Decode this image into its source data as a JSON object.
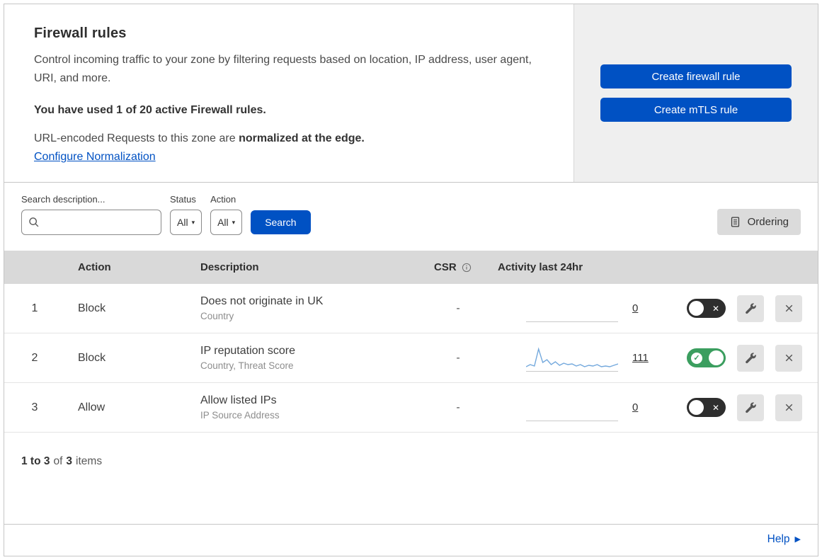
{
  "header": {
    "title": "Firewall rules",
    "description": "Control incoming traffic to your zone by filtering requests based on location, IP address, user agent, URI, and more.",
    "usage": "You have used 1 of 20 active Firewall rules.",
    "normalization_prefix": "URL-encoded Requests to this zone are ",
    "normalization_bold": "normalized at the edge.",
    "normalization_link": "Configure Normalization",
    "create_firewall_label": "Create firewall rule",
    "create_mtls_label": "Create mTLS rule"
  },
  "filters": {
    "search_label": "Search description...",
    "status_label": "Status",
    "status_value": "All",
    "action_label": "Action",
    "action_value": "All",
    "search_button": "Search",
    "ordering_button": "Ordering"
  },
  "table": {
    "headers": {
      "action": "Action",
      "description": "Description",
      "csr": "CSR",
      "activity": "Activity last 24hr"
    },
    "rows": [
      {
        "priority": "1",
        "action": "Block",
        "description": "Does not originate in UK",
        "criteria": "Country",
        "csr": "-",
        "activity_count": "0",
        "enabled": false
      },
      {
        "priority": "2",
        "action": "Block",
        "description": "IP reputation score",
        "criteria": "Country, Threat Score",
        "csr": "-",
        "activity_count": "111",
        "enabled": true,
        "sparkline": [
          3,
          6,
          4,
          28,
          9,
          13,
          6,
          10,
          5,
          8,
          6,
          7,
          4,
          6,
          3,
          5,
          4,
          6,
          3,
          4,
          3,
          5,
          7
        ]
      },
      {
        "priority": "3",
        "action": "Allow",
        "description": "Allow listed IPs",
        "criteria": "IP Source Address",
        "csr": "-",
        "activity_count": "0",
        "enabled": false
      }
    ]
  },
  "footer": {
    "range": "1 to 3",
    "of_text": "of",
    "total": "3",
    "items_text": "items",
    "help_label": "Help"
  },
  "colors": {
    "primary_blue": "#0051c3",
    "toggle_on_green": "#3b9e5f",
    "toggle_off_dark": "#2e2e2e",
    "table_header_gray": "#d9d9d9",
    "panel_gray": "#efefef",
    "sparkline_blue": "#74a9dd"
  }
}
